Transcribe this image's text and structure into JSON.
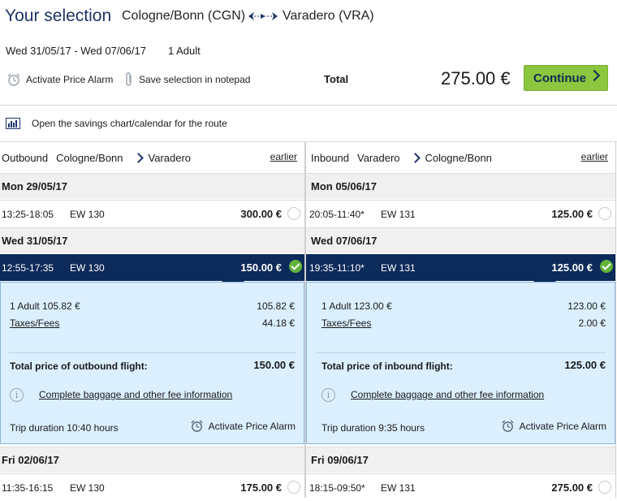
{
  "header": {
    "title": "Your selection",
    "from": "Cologne/Bonn (CGN)",
    "to": "Varadero (VRA)",
    "dates": "Wed 31/05/17 - Wed 07/06/17",
    "passengers": "1 Adult",
    "price_alarm": "Activate Price Alarm",
    "notepad": "Save selection in notepad",
    "total_label": "Total",
    "total_price": "275.00 €",
    "continue_label": "Continue",
    "savings_link": "Open the savings chart/calendar for the route"
  },
  "outbound": {
    "label": "Outbound",
    "from": "Cologne/Bonn",
    "to": "Varadero",
    "earlier": "earlier",
    "days": [
      {
        "date": "Mon 29/05/17",
        "time": "13:25-18:05",
        "flight": "EW 130",
        "price": "300.00 €"
      },
      {
        "date": "Wed 31/05/17",
        "time": "12:55-17:35",
        "flight": "EW 130",
        "price": "150.00 €"
      },
      {
        "date": "Fri 02/06/17",
        "time": "11:35-16:15",
        "flight": "EW 130",
        "price": "175.00 €"
      }
    ],
    "detail": {
      "fare_label": "1 Adult 105.82 €",
      "fare_value": "105.82 €",
      "taxes_label": "Taxes/Fees",
      "taxes_value": "44.18 €",
      "total_label": "Total price of outbound flight:",
      "total_value": "150.00 €",
      "baggage_link": "Complete baggage and other fee information",
      "duration": "Trip duration 10:40  hours",
      "alarm": "Activate Price Alarm"
    }
  },
  "inbound": {
    "label": "Inbound",
    "from": "Varadero",
    "to": "Cologne/Bonn",
    "earlier": "earlier",
    "days": [
      {
        "date": "Mon 05/06/17",
        "time": "20:05-11:40*",
        "flight": "EW 131",
        "price": "125.00 €"
      },
      {
        "date": "Wed 07/06/17",
        "time": "19:35-11:10*",
        "flight": "EW 131",
        "price": "125.00 €"
      },
      {
        "date": "Fri 09/06/17",
        "time": "18:15-09:50*",
        "flight": "EW 131",
        "price": "275.00 €"
      }
    ],
    "detail": {
      "fare_label": "1 Adult 123.00 €",
      "fare_value": "123.00 €",
      "taxes_label": "Taxes/Fees",
      "taxes_value": "2.00 €",
      "total_label": "Total price of inbound flight:",
      "total_value": "125.00 €",
      "baggage_link": "Complete baggage and other fee information",
      "duration": "Trip duration 9:35  hours",
      "alarm": "Activate Price Alarm"
    }
  },
  "colors": {
    "navy": "#0c2a5a",
    "accent_green": "#8cc63f",
    "detail_bg": "#dbefff"
  }
}
